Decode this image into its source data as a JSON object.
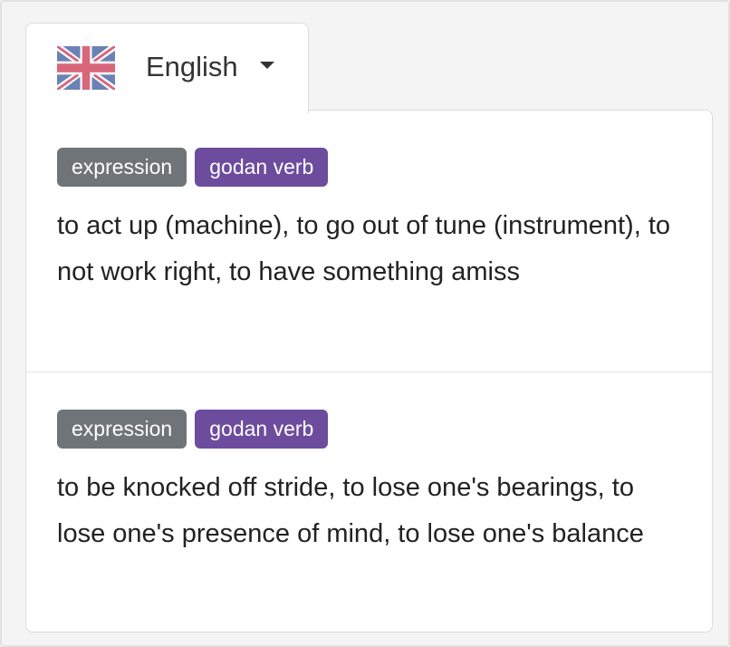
{
  "language_selector": {
    "flag_icon": "uk-flag-icon",
    "label": "English",
    "dropdown_icon": "caret-down-icon"
  },
  "senses": [
    {
      "tags": [
        {
          "label": "expression",
          "color": "#6f7479"
        },
        {
          "label": "godan verb",
          "color": "#6d4c9e"
        }
      ],
      "gloss": "to act up (machine), to go out of tune (instrument), to not work right, to have something amiss"
    },
    {
      "tags": [
        {
          "label": "expression",
          "color": "#6f7479"
        },
        {
          "label": "godan verb",
          "color": "#6d4c9e"
        }
      ],
      "gloss": "to be knocked off stride, to lose one's bearings, to lose one's presence of mind, to lose one's balance"
    }
  ]
}
